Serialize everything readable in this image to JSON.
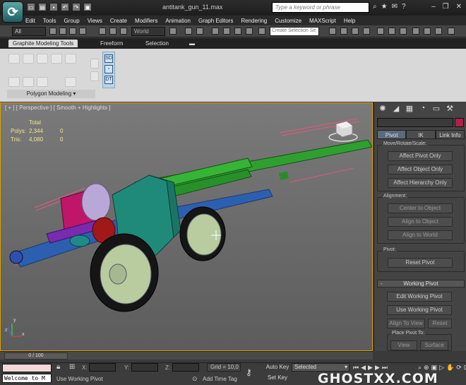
{
  "titlebar": {
    "app_icon": "3ds-max-logo",
    "window_title": "antitank_gun_11.max",
    "search_placeholder": "Type a keyword or phrase"
  },
  "menu": [
    "Edit",
    "Tools",
    "Group",
    "Views",
    "Create",
    "Modifiers",
    "Animation",
    "Graph Editors",
    "Rendering",
    "Customize",
    "MAXScript",
    "Help"
  ],
  "toolbar": {
    "selection_filter": "All",
    "ref_coord_system": "World",
    "named_selection_placeholder": "Create Selection Se"
  },
  "ribbon": {
    "tabs": [
      "Graphite Modeling Tools",
      "Freeform",
      "Selection"
    ],
    "active_tab": "Graphite Modeling Tools",
    "panel_label": "Polygon Modeling"
  },
  "viewport": {
    "label": "[ + ] [ Perspective ] [ Smooth + Highlights ]",
    "stats": {
      "header": "Total",
      "polys_label": "Polys:",
      "polys_total": "2,344",
      "polys_sel": "0",
      "tris_label": "Tris:",
      "tris_total": "4,080",
      "tris_sel": "0"
    },
    "axis": {
      "x": "x",
      "y": "y",
      "z": "z"
    }
  },
  "command_panel": {
    "hierarchy_tabs": [
      "Pivot",
      "IK",
      "Link Info"
    ],
    "active_tab": "Pivot",
    "move_rotate_scale": {
      "title": "Move/Rotate/Scale:",
      "buttons": [
        "Affect Pivot Only",
        "Affect Object Only",
        "Affect Hierarchy Only"
      ]
    },
    "alignment": {
      "title": "Alignment:",
      "buttons": [
        "Center to Object",
        "Align to Object",
        "Align to World"
      ]
    },
    "pivot": {
      "title": "Pivot:",
      "button": "Reset Pivot"
    },
    "working_pivot": {
      "header": "Working Pivot",
      "collapse": "-",
      "edit_button": "Edit Working Pivot",
      "use_button": "Use Working Pivot",
      "align_to_view": "Align To View",
      "reset": "Reset",
      "place_title": "Place Pivot To:",
      "view": "View",
      "surface": "Surface"
    }
  },
  "timeline": {
    "slider_label": "0 / 100"
  },
  "statusbar": {
    "maxscript_listener": "Welcome to M",
    "x_label": "X:",
    "y_label": "Y:",
    "z_label": "Z:",
    "grid": "Grid = 10,0",
    "prompt": "Use Working Pivot",
    "add_time_tag": "Add Time Tag",
    "auto_key": "Auto Key",
    "set_key": "Set Key",
    "selected_option": "Selected"
  },
  "watermark": "GHOSTXX.COM",
  "colors": {
    "barrel": "#2fa02f",
    "shield": "#1f8a7a",
    "wheel_tire": "#151515",
    "wheel_hub": "#b8cca0",
    "carriage": "#2d5fb0",
    "viewport_border": "#d8a000",
    "object_color": "#b0204a"
  }
}
